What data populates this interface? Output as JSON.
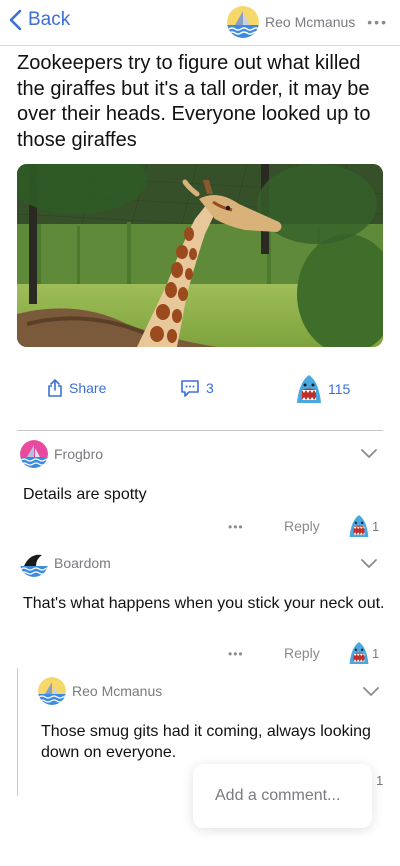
{
  "header": {
    "back_label": "Back",
    "author_name": "Reo Mcmanus",
    "more_label": "•••"
  },
  "post": {
    "title": "Zookeepers try to figure out what killed the giraffes but it's a tall order, it may be over their heads. Everyone looked up to those giraffes",
    "image_description": "giraffe-photo"
  },
  "actions": {
    "share_label": "Share",
    "comments_count": "3",
    "votes_count": "115"
  },
  "comments": [
    {
      "user": "Frogbro",
      "text": "Details are spotty",
      "reply_label": "Reply",
      "more_label": "•••",
      "votes": "1"
    },
    {
      "user": "Boardom",
      "text": "That's what happens when you stick your neck out.",
      "reply_label": "Reply",
      "more_label": "•••",
      "votes": "1"
    },
    {
      "user": "Reo Mcmanus",
      "text": "Those smug gits had it coming, always looking down on everyone.",
      "votes": "1"
    }
  ],
  "composer": {
    "placeholder": "Add a comment..."
  },
  "colors": {
    "accent": "#3b6fd6",
    "muted": "#7a7a80",
    "divider": "#c8c8cc"
  }
}
